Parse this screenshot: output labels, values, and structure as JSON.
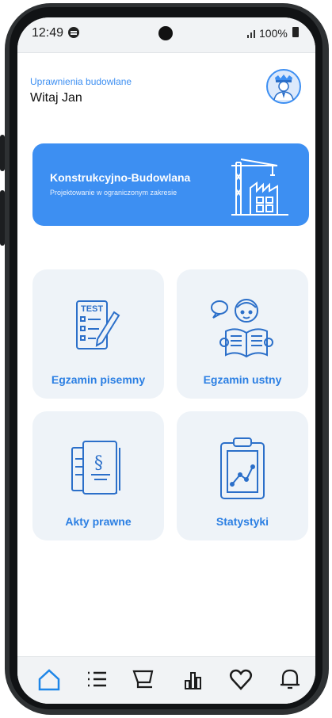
{
  "status_bar": {
    "time": "12:49",
    "battery_text": "100%"
  },
  "header": {
    "subtitle": "Uprawnienia budowlane",
    "greeting": "Witaj Jan"
  },
  "banner": {
    "title": "Konstrukcyjno-Budowlana",
    "subtitle": "Projektowanie w ograniczonym zakresie"
  },
  "cards": [
    {
      "label": "Egzamin pisemny",
      "icon": "test-sheet-icon"
    },
    {
      "label": "Egzamin ustny",
      "icon": "oral-exam-icon"
    },
    {
      "label": "Akty prawne",
      "icon": "legal-acts-icon"
    },
    {
      "label": "Statystyki",
      "icon": "statistics-icon"
    }
  ],
  "test_icon_text": "TEST",
  "nav": [
    "home-icon",
    "list-icon",
    "cart-icon",
    "chart-icon",
    "heart-icon",
    "bell-icon"
  ],
  "colors": {
    "accent": "#3d8ff2",
    "card_bg": "#eef3f8",
    "label": "#2b7fe3"
  }
}
